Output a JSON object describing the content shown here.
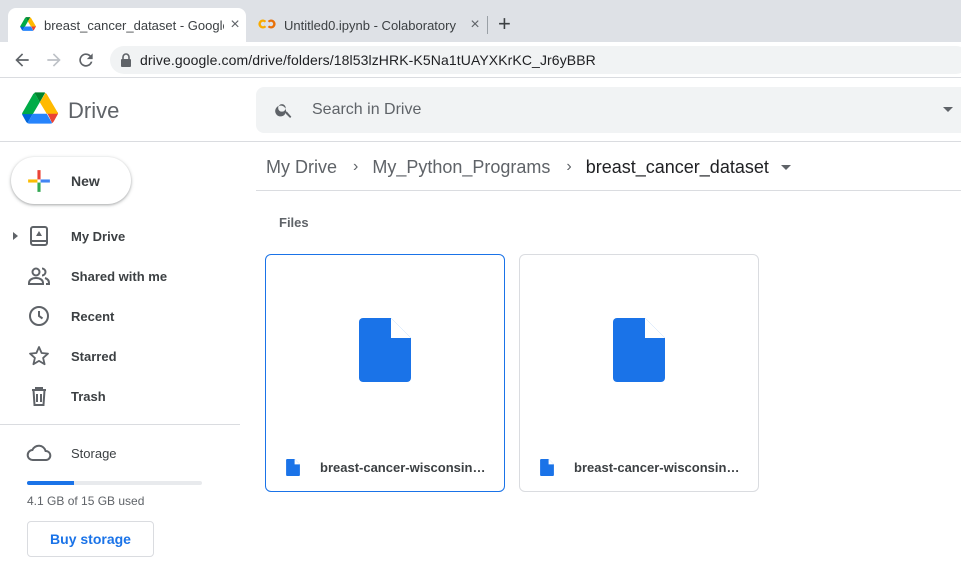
{
  "browser": {
    "tabs": [
      {
        "title": "breast_cancer_dataset - Google Drive",
        "icon": "google-drive-icon",
        "active": true
      },
      {
        "title": "Untitled0.ipynb - Colaboratory",
        "icon": "colab-icon",
        "active": false
      }
    ],
    "url": "drive.google.com/drive/folders/18l53lzHRK-K5Na1tUAYXKrKC_Jr6yBBR"
  },
  "drive": {
    "app_name": "Drive",
    "search_placeholder": "Search in Drive"
  },
  "sidebar": {
    "new_label": "New",
    "items": [
      {
        "label": "My Drive",
        "icon": "my-drive-icon"
      },
      {
        "label": "Shared with me",
        "icon": "shared-people-icon"
      },
      {
        "label": "Recent",
        "icon": "clock-icon"
      },
      {
        "label": "Starred",
        "icon": "star-icon"
      },
      {
        "label": "Trash",
        "icon": "trash-icon"
      }
    ],
    "storage_label": "Storage",
    "storage_used_text": "4.1 GB of 15 GB used",
    "storage_used_fraction": 0.27,
    "buy_storage_label": "Buy storage"
  },
  "main": {
    "breadcrumb": [
      "My Drive",
      "My_Python_Programs",
      "breast_cancer_dataset"
    ],
    "section_title": "Files",
    "files": [
      {
        "name": "breast-cancer-wisconsin.data",
        "icon": "document-icon",
        "selected": true
      },
      {
        "name": "breast-cancer-wisconsin.names",
        "icon": "document-icon",
        "selected": false
      }
    ]
  },
  "colors": {
    "accent": "#1a73e8",
    "drive_green": "#0f9d58",
    "drive_yellow": "#f4b400",
    "drive_blue": "#4285f4",
    "drive_red": "#db4437"
  }
}
